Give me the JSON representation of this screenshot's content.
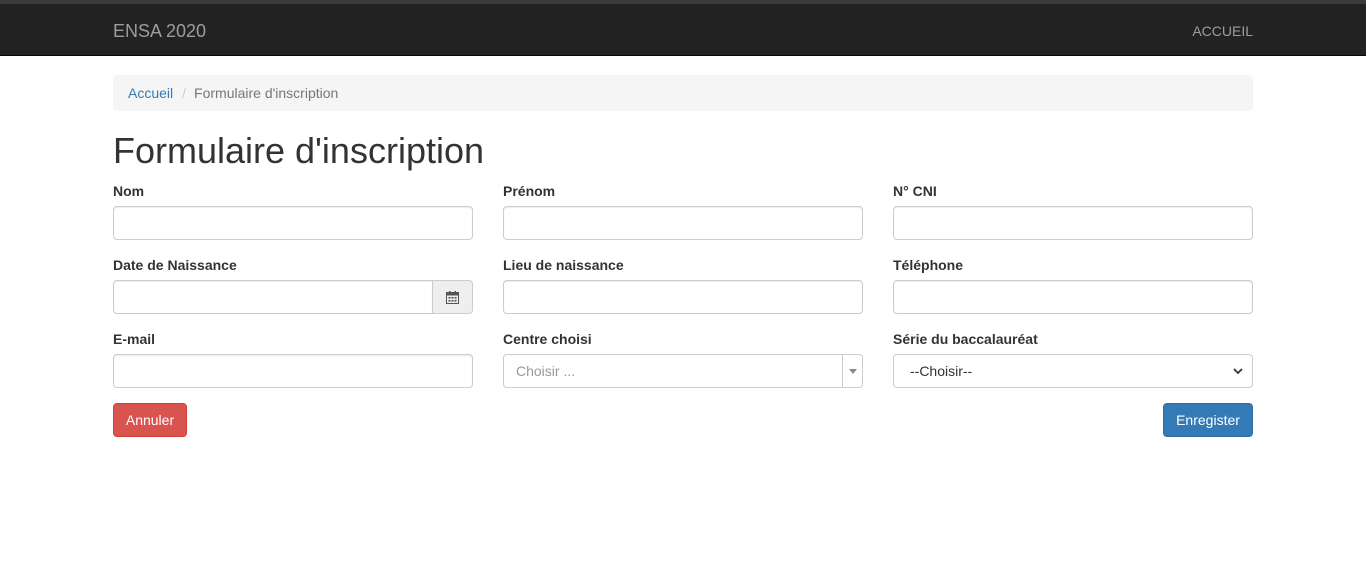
{
  "navbar": {
    "brand": "ENSA 2020",
    "home_link": "ACCUEIL"
  },
  "breadcrumb": {
    "home": "Accueil",
    "separator": "/",
    "current": "Formulaire d'inscription"
  },
  "page": {
    "title": "Formulaire d'inscription"
  },
  "form": {
    "nom": {
      "label": "Nom",
      "value": ""
    },
    "prenom": {
      "label": "Prénom",
      "value": ""
    },
    "cni": {
      "label": "N° CNI",
      "value": ""
    },
    "date_naissance": {
      "label": "Date de Naissance",
      "value": "",
      "icon": "calendar-icon"
    },
    "lieu_naissance": {
      "label": "Lieu de naissance",
      "value": ""
    },
    "telephone": {
      "label": "Téléphone",
      "value": ""
    },
    "email": {
      "label": "E-mail",
      "value": ""
    },
    "centre": {
      "label": "Centre choisi",
      "placeholder": "Choisir ..."
    },
    "serie_bac": {
      "label": "Série du baccalauréat",
      "selected": "--Choisir--"
    }
  },
  "actions": {
    "cancel_label": "Annuler",
    "save_label": "Enregister"
  },
  "colors": {
    "navbar_bg": "#222222",
    "link": "#337ab7",
    "danger": "#d9534f",
    "primary": "#337ab7"
  }
}
